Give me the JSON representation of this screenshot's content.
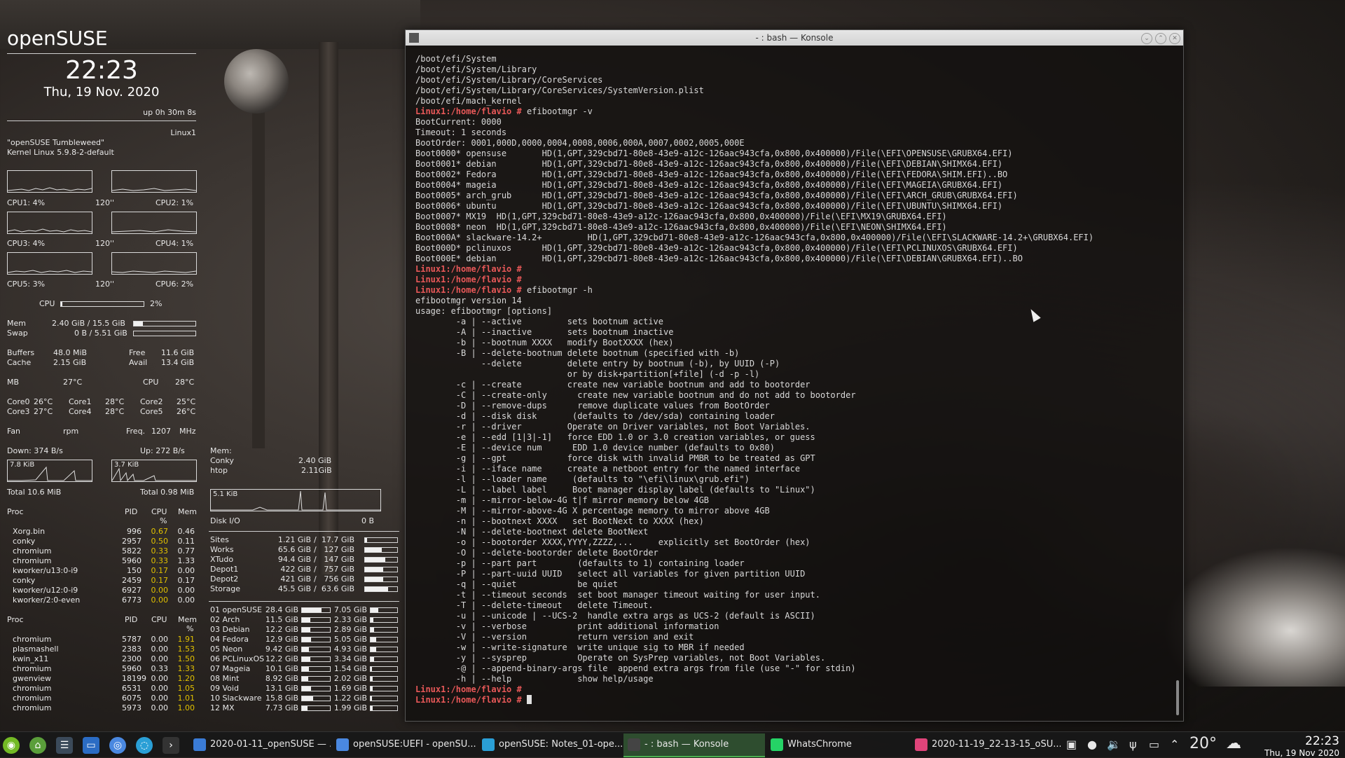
{
  "conky": {
    "os_name": "openSUSE",
    "time": "22:23",
    "date": "Thu, 19 Nov. 2020",
    "uptime": "up  0h 30m 8s",
    "hostname": "Linux1",
    "distro": "\"openSUSE Tumbleweed\"",
    "kernel": "Kernel Linux 5.9.8-2-default",
    "cpus": [
      {
        "label": "CPU1: 4%",
        "freq": "120''"
      },
      {
        "label": "CPU2: 1%",
        "freq": ""
      },
      {
        "label": "CPU3: 4%",
        "freq": "120''"
      },
      {
        "label": "CPU4: 1%",
        "freq": ""
      },
      {
        "label": "CPU5: 3%",
        "freq": "120''"
      },
      {
        "label": "CPU6: 2%",
        "freq": ""
      }
    ],
    "cpu_total": {
      "label": "CPU",
      "value": "2%",
      "level": 0.02
    },
    "mem": {
      "label": "Mem",
      "value": "2.40 GiB / 15.5 GiB",
      "level": 0.15
    },
    "swap": {
      "label": "Swap",
      "value": "0 B / 5.51 GiB",
      "level": 0.0
    },
    "buffers": {
      "label": "Buffers",
      "value": "48.0 MiB"
    },
    "free": {
      "label": "Free",
      "value": "11.6 GiB"
    },
    "cache": {
      "label": "Cache",
      "value": "2.15 GiB"
    },
    "avail": {
      "label": "Avail",
      "value": "13.4 GiB"
    },
    "mb": {
      "label": "MB",
      "value": "27°C"
    },
    "cpu_temp": {
      "label": "CPU",
      "value": "28°C"
    },
    "cores": [
      {
        "label": "Core0",
        "value": "26°C"
      },
      {
        "label": "Core1",
        "value": "28°C"
      },
      {
        "label": "Core2",
        "value": "25°C"
      },
      {
        "label": "Core3",
        "value": "27°C"
      },
      {
        "label": "Core4",
        "value": "28°C"
      },
      {
        "label": "Core5",
        "value": "26°C"
      }
    ],
    "fan": {
      "label": "Fan",
      "value": "rpm"
    },
    "freq": {
      "label": "Freq.",
      "value": "1207",
      "unit": "MHz"
    },
    "down": "Down: 374 B/s",
    "up": "Up: 272 B/s",
    "down_graph": "7.8 KiB",
    "up_graph": "3.7 KiB",
    "down_total": "Total 10.6 MiB",
    "up_total": "Total 0.98 MiB",
    "proc_header": {
      "name": "Proc",
      "pid": "PID",
      "cpu": "CPU",
      "mem": "Mem",
      "pct": "%"
    },
    "proc_cpu": [
      {
        "name": "Xorg.bin",
        "pid": "996",
        "cpu": "0.67",
        "mem": "0.46"
      },
      {
        "name": "conky",
        "pid": "2957",
        "cpu": "0.50",
        "mem": "0.11"
      },
      {
        "name": "chromium",
        "pid": "5822",
        "cpu": "0.33",
        "mem": "0.77"
      },
      {
        "name": "chromium",
        "pid": "5960",
        "cpu": "0.33",
        "mem": "1.33"
      },
      {
        "name": "kworker/u13:0-i9",
        "pid": "150",
        "cpu": "0.17",
        "mem": "0.00"
      },
      {
        "name": "conky",
        "pid": "2459",
        "cpu": "0.17",
        "mem": "0.17"
      },
      {
        "name": "kworker/u12:0-i9",
        "pid": "6927",
        "cpu": "0.00",
        "mem": "0.00"
      },
      {
        "name": "kworker/2:0-even",
        "pid": "6773",
        "cpu": "0.00",
        "mem": "0.00"
      }
    ],
    "proc_mem": [
      {
        "name": "chromium",
        "pid": "5787",
        "cpu": "0.00",
        "mem": "1.91"
      },
      {
        "name": "plasmashell",
        "pid": "2383",
        "cpu": "0.00",
        "mem": "1.53"
      },
      {
        "name": "kwin_x11",
        "pid": "2300",
        "cpu": "0.00",
        "mem": "1.50"
      },
      {
        "name": "chromium",
        "pid": "5960",
        "cpu": "0.33",
        "mem": "1.33"
      },
      {
        "name": "gwenview",
        "pid": "18199",
        "cpu": "0.00",
        "mem": "1.20"
      },
      {
        "name": "chromium",
        "pid": "6531",
        "cpu": "0.00",
        "mem": "1.05"
      },
      {
        "name": "chromium",
        "pid": "6075",
        "cpu": "0.00",
        "mem": "1.01"
      },
      {
        "name": "chromium",
        "pid": "5973",
        "cpu": "0.00",
        "mem": "1.00"
      }
    ],
    "memuse": {
      "label": "Mem:",
      "rows": [
        {
          "name": "Conky",
          "value": "2.40 GiB"
        },
        {
          "name": "htop",
          "value": "2.11GiB"
        }
      ]
    },
    "disk_io": {
      "label": "Disk I/O",
      "value": "0 B",
      "graph": "5.1 KiB"
    },
    "mounts": [
      {
        "name": "Sites",
        "used": "1.21 GiB",
        "total": "17.7 GiB",
        "level": 0.07
      },
      {
        "name": "Works",
        "used": "65.6 GiB",
        "total": "127 GiB",
        "level": 0.52
      },
      {
        "name": "XTudo",
        "used": "94.4 GiB",
        "total": "147 GiB",
        "level": 0.64
      },
      {
        "name": "Depot1",
        "used": "422 GiB",
        "total": "757 GiB",
        "level": 0.56
      },
      {
        "name": "Depot2",
        "used": "421 GiB",
        "total": "756 GiB",
        "level": 0.56
      },
      {
        "name": "Storage",
        "used": "45.5 GiB",
        "total": "63.6 GiB",
        "level": 0.72
      }
    ],
    "partitions": [
      {
        "name": "01 openSUSE",
        "a": "28.4 GiB",
        "al": 0.7,
        "b": "7.05 GiB",
        "bl": 0.3
      },
      {
        "name": "02 Arch",
        "a": "11.5 GiB",
        "al": 0.3,
        "b": "2.33 GiB",
        "bl": 0.1
      },
      {
        "name": "03 Debian",
        "a": "12.2 GiB",
        "al": 0.3,
        "b": "2.89 GiB",
        "bl": 0.12
      },
      {
        "name": "04 Fedora",
        "a": "12.9 GiB",
        "al": 0.32,
        "b": "5.05 GiB",
        "bl": 0.2
      },
      {
        "name": "05 Neon",
        "a": "9.42 GiB",
        "al": 0.25,
        "b": "4.93 GiB",
        "bl": 0.2
      },
      {
        "name": "06 PCLinuxOS",
        "a": "12.2 GiB",
        "al": 0.3,
        "b": "3.34 GiB",
        "bl": 0.14
      },
      {
        "name": "07 Mageia",
        "a": "10.1 GiB",
        "al": 0.26,
        "b": "1.54 GiB",
        "bl": 0.06
      },
      {
        "name": "08 Mint",
        "a": "8.92 GiB",
        "al": 0.22,
        "b": "2.02 GiB",
        "bl": 0.08
      },
      {
        "name": "09 Void",
        "a": "13.1 GiB",
        "al": 0.33,
        "b": "1.69 GiB",
        "bl": 0.07
      },
      {
        "name": "10 Slackware",
        "a": "15.8 GiB",
        "al": 0.4,
        "b": "1.22 GiB",
        "bl": 0.05
      },
      {
        "name": "12 MX",
        "a": "7.73 GiB",
        "al": 0.2,
        "b": "1.99 GiB",
        "bl": 0.08
      }
    ]
  },
  "konsole": {
    "title": "- : bash — Konsole",
    "lines": [
      {
        "t": "/boot/efi/System"
      },
      {
        "t": "/boot/efi/System/Library"
      },
      {
        "t": "/boot/efi/System/Library/CoreServices"
      },
      {
        "t": "/boot/efi/System/Library/CoreServices/SystemVersion.plist"
      },
      {
        "t": "/boot/efi/mach_kernel"
      },
      {
        "p": "Linux1:/home/flavio #",
        "t": " efibootmgr -v"
      },
      {
        "t": "BootCurrent: 0000"
      },
      {
        "t": "Timeout: 1 seconds"
      },
      {
        "t": "BootOrder: 0001,000D,0000,0004,0008,0006,000A,0007,0002,0005,000E"
      },
      {
        "t": "Boot0000* opensuse       HD(1,GPT,329cbd71-80e8-43e9-a12c-126aac943cfa,0x800,0x400000)/File(\\EFI\\OPENSUSE\\GRUBX64.EFI)"
      },
      {
        "t": "Boot0001* debian         HD(1,GPT,329cbd71-80e8-43e9-a12c-126aac943cfa,0x800,0x400000)/File(\\EFI\\DEBIAN\\SHIMX64.EFI)"
      },
      {
        "t": "Boot0002* Fedora         HD(1,GPT,329cbd71-80e8-43e9-a12c-126aac943cfa,0x800,0x400000)/File(\\EFI\\FEDORA\\SHIM.EFI)..BO"
      },
      {
        "t": "Boot0004* mageia         HD(1,GPT,329cbd71-80e8-43e9-a12c-126aac943cfa,0x800,0x400000)/File(\\EFI\\MAGEIA\\GRUBX64.EFI)"
      },
      {
        "t": "Boot0005* arch_grub      HD(1,GPT,329cbd71-80e8-43e9-a12c-126aac943cfa,0x800,0x400000)/File(\\EFI\\ARCH_GRUB\\GRUBX64.EFI)"
      },
      {
        "t": "Boot0006* ubuntu         HD(1,GPT,329cbd71-80e8-43e9-a12c-126aac943cfa,0x800,0x400000)/File(\\EFI\\UBUNTU\\SHIMX64.EFI)"
      },
      {
        "t": "Boot0007* MX19  HD(1,GPT,329cbd71-80e8-43e9-a12c-126aac943cfa,0x800,0x400000)/File(\\EFI\\MX19\\GRUBX64.EFI)"
      },
      {
        "t": "Boot0008* neon  HD(1,GPT,329cbd71-80e8-43e9-a12c-126aac943cfa,0x800,0x400000)/File(\\EFI\\NEON\\SHIMX64.EFI)"
      },
      {
        "t": "Boot000A* slackware-14.2+         HD(1,GPT,329cbd71-80e8-43e9-a12c-126aac943cfa,0x800,0x400000)/File(\\EFI\\SLACKWARE-14.2+\\GRUBX64.EFI)"
      },
      {
        "t": "Boot000D* pclinuxos      HD(1,GPT,329cbd71-80e8-43e9-a12c-126aac943cfa,0x800,0x400000)/File(\\EFI\\PCLINUXOS\\GRUBX64.EFI)"
      },
      {
        "t": "Boot000E* debian         HD(1,GPT,329cbd71-80e8-43e9-a12c-126aac943cfa,0x800,0x400000)/File(\\EFI\\DEBIAN\\GRUBX64.EFI)..BO"
      },
      {
        "p": "Linux1:/home/flavio #",
        "t": ""
      },
      {
        "p": "Linux1:/home/flavio #",
        "t": ""
      },
      {
        "p": "Linux1:/home/flavio #",
        "t": " efibootmgr -h"
      },
      {
        "t": "efibootmgr version 14"
      },
      {
        "t": "usage: efibootmgr [options]"
      },
      {
        "t": "        -a | --active         sets bootnum active"
      },
      {
        "t": "        -A | --inactive       sets bootnum inactive"
      },
      {
        "t": "        -b | --bootnum XXXX   modify BootXXXX (hex)"
      },
      {
        "t": "        -B | --delete-bootnum delete bootnum (specified with -b)"
      },
      {
        "t": "             --delete         delete entry by bootnum (-b), by UUID (-P)"
      },
      {
        "t": "                              or by disk+partition[+file] (-d -p -l)"
      },
      {
        "t": "        -c | --create         create new variable bootnum and add to bootorder"
      },
      {
        "t": "        -C | --create-only      create new variable bootnum and do not add to bootorder"
      },
      {
        "t": "        -D | --remove-dups      remove duplicate values from BootOrder"
      },
      {
        "t": "        -d | --disk disk       (defaults to /dev/sda) containing loader"
      },
      {
        "t": "        -r | --driver         Operate on Driver variables, not Boot Variables."
      },
      {
        "t": "        -e | --edd [1|3|-1]   force EDD 1.0 or 3.0 creation variables, or guess"
      },
      {
        "t": "        -E | --device num      EDD 1.0 device number (defaults to 0x80)"
      },
      {
        "t": "        -g | --gpt            force disk with invalid PMBR to be treated as GPT"
      },
      {
        "t": "        -i | --iface name     create a netboot entry for the named interface"
      },
      {
        "t": "        -l | --loader name     (defaults to \"\\efi\\linux\\grub.efi\")"
      },
      {
        "t": "        -L | --label label     Boot manager display label (defaults to \"Linux\")"
      },
      {
        "t": "        -m | --mirror-below-4G t|f mirror memory below 4GB"
      },
      {
        "t": "        -M | --mirror-above-4G X percentage memory to mirror above 4GB"
      },
      {
        "t": "        -n | --bootnext XXXX   set BootNext to XXXX (hex)"
      },
      {
        "t": "        -N | --delete-bootnext delete BootNext"
      },
      {
        "t": "        -o | --bootorder XXXX,YYYY,ZZZZ,...     explicitly set BootOrder (hex)"
      },
      {
        "t": "        -O | --delete-bootorder delete BootOrder"
      },
      {
        "t": "        -p | --part part        (defaults to 1) containing loader"
      },
      {
        "t": "        -P | --part-uuid UUID   select all variables for given partition UUID"
      },
      {
        "t": "        -q | --quiet            be quiet"
      },
      {
        "t": "        -t | --timeout seconds  set boot manager timeout waiting for user input."
      },
      {
        "t": "        -T | --delete-timeout   delete Timeout."
      },
      {
        "t": "        -u | --unicode | --UCS-2  handle extra args as UCS-2 (default is ASCII)"
      },
      {
        "t": "        -v | --verbose          print additional information"
      },
      {
        "t": "        -V | --version          return version and exit"
      },
      {
        "t": "        -w | --write-signature  write unique sig to MBR if needed"
      },
      {
        "t": "        -y | --sysprep          Operate on SysPrep variables, not Boot Variables."
      },
      {
        "t": "        -@ | --append-binary-args file  append extra args from file (use \"-\" for stdin)"
      },
      {
        "t": "        -h | --help             show help/usage"
      },
      {
        "p": "Linux1:/home/flavio #",
        "t": ""
      },
      {
        "p": "Linux1:/home/flavio #",
        "t": "",
        "cursor": true
      }
    ]
  },
  "taskbar": {
    "tasks": [
      {
        "label": "2020-01-11_openSUSE — ...",
        "icon": "folder-icon",
        "color": "#3a7bd5"
      },
      {
        "label": "openSUSE:UEFI - openSU...",
        "icon": "chromium-icon",
        "color": "#4a88e0"
      },
      {
        "label": "openSUSE: Notes_01-ope...",
        "icon": "browser-icon",
        "color": "#2a9fd6"
      },
      {
        "label": "- : bash — Konsole",
        "icon": "konsole-icon",
        "color": "#444",
        "active": true
      },
      {
        "label": "WhatsChrome",
        "icon": "whatsapp-icon",
        "color": "#25d366"
      },
      {
        "label": "2020-11-19_22-13-15_oSU...",
        "icon": "gwenview-icon",
        "color": "#e0447a"
      }
    ],
    "temperature": "20°",
    "clock_time": "22:23",
    "clock_date": "Thu, 19 Nov 2020"
  }
}
